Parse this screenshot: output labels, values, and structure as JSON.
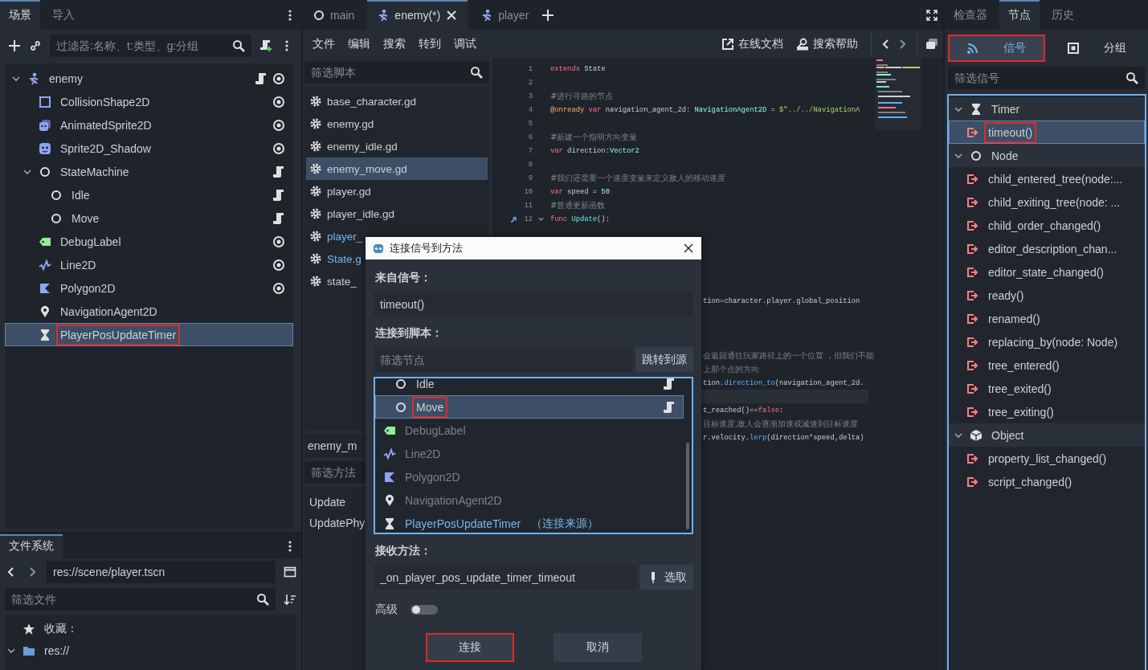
{
  "scene_dock": {
    "tabs": [
      {
        "label": "场景",
        "selected": true
      },
      {
        "label": "导入",
        "selected": false
      }
    ],
    "filter": {
      "placeholder": "过滤器:名称、t:类型、g:分组"
    },
    "tree": [
      {
        "name": "enemy",
        "kind": "character",
        "script": true,
        "eye": true,
        "selected": false,
        "highlighted": false,
        "expanded": true,
        "children": [
          {
            "name": "CollisionShape2D",
            "kind": "collision",
            "script": false,
            "eye": true,
            "selected": false,
            "highlighted": false
          },
          {
            "name": "AnimatedSprite2D",
            "kind": "animated",
            "script": false,
            "eye": true,
            "selected": false,
            "highlighted": false
          },
          {
            "name": "Sprite2D_Shadow",
            "kind": "sprite",
            "script": false,
            "eye": true,
            "selected": false,
            "highlighted": false
          },
          {
            "name": "StateMachine",
            "kind": "node",
            "script": true,
            "eye": false,
            "selected": false,
            "highlighted": false,
            "expanded": true,
            "children": [
              {
                "name": "Idle",
                "kind": "node",
                "script": true,
                "eye": false,
                "selected": false,
                "highlighted": false
              },
              {
                "name": "Move",
                "kind": "node",
                "script": true,
                "eye": false,
                "selected": false,
                "highlighted": false
              }
            ]
          },
          {
            "name": "DebugLabel",
            "kind": "label",
            "script": false,
            "eye": true,
            "selected": false,
            "highlighted": false
          },
          {
            "name": "Line2D",
            "kind": "line",
            "script": false,
            "eye": true,
            "selected": false,
            "highlighted": false
          },
          {
            "name": "Polygon2D",
            "kind": "polygon",
            "script": false,
            "eye": true,
            "selected": false,
            "highlighted": false
          },
          {
            "name": "NavigationAgent2D",
            "kind": "navigation",
            "script": false,
            "eye": false,
            "selected": false,
            "highlighted": false
          },
          {
            "name": "PlayerPosUpdateTimer",
            "kind": "timer",
            "script": false,
            "eye": false,
            "selected": true,
            "highlighted": true
          }
        ]
      }
    ]
  },
  "file_dock": {
    "tabs": [
      {
        "label": "文件系统",
        "selected": true
      }
    ],
    "path": "res://scene/player.tscn",
    "filter": {
      "placeholder": "筛选文件"
    },
    "items": [
      {
        "label": "收藏：",
        "kind": "favorites"
      },
      {
        "label": "res://",
        "kind": "folder",
        "expanded": true
      }
    ]
  },
  "script_editor": {
    "tabs": [
      {
        "label": "main",
        "kind": "node",
        "selected": false,
        "closable": false
      },
      {
        "label": "enemy(*)",
        "kind": "character",
        "selected": true,
        "closable": true
      },
      {
        "label": "player",
        "kind": "character",
        "selected": false,
        "closable": false
      }
    ],
    "menu": [
      "文件",
      "编辑",
      "搜索",
      "转到",
      "调试"
    ],
    "tools": [
      {
        "label": "在线文档",
        "kind": "external"
      },
      {
        "label": "搜索帮助",
        "kind": "doc"
      }
    ],
    "script_filter": {
      "placeholder": "筛选脚本"
    },
    "scripts": [
      {
        "label": "base_character.gd",
        "selected": false,
        "color": "#cdcfd2"
      },
      {
        "label": "enemy.gd",
        "selected": false,
        "color": "#cdcfd2"
      },
      {
        "label": "enemy_idle.gd",
        "selected": false,
        "color": "#cdcfd2"
      },
      {
        "label": "enemy_move.gd",
        "selected": true,
        "color": "#cdcfd2"
      },
      {
        "label": "player.gd",
        "selected": false,
        "color": "#cdcfd2"
      },
      {
        "label": "player_idle.gd",
        "selected": false,
        "color": "#cdcfd2"
      },
      {
        "label": "player_",
        "selected": false,
        "color": "#78b6ec"
      },
      {
        "label": "State.g",
        "selected": false,
        "color": "#78b6ec"
      },
      {
        "label": "state_",
        "selected": false,
        "color": "#cdcfd2"
      }
    ],
    "method_panel": {
      "title": "enemy_m",
      "filter": {
        "placeholder": "筛选方法"
      },
      "methods": [
        "Update",
        "UpdatePhy"
      ]
    },
    "code": {
      "lines": [
        {
          "kind": "full",
          "number": "1",
          "tokens": [
            {
              "kind": "kw",
              "s": "extends"
            },
            {
              "kind": "text",
              "s": " State"
            }
          ]
        },
        {
          "kind": "full",
          "number": "2"
        },
        {
          "kind": "full",
          "number": "3",
          "tokens": [
            {
              "kind": "comment",
              "s": "#进行寻路的节点"
            }
          ]
        },
        {
          "kind": "full",
          "number": "4",
          "tokens": [
            {
              "kind": "annot",
              "s": "@onready"
            },
            {
              "kind": "kw",
              "s": " var"
            },
            {
              "kind": "text",
              "s": " navigation_agent_2d: "
            },
            {
              "kind": "type",
              "s": "NavigationAgent2D"
            },
            {
              "kind": "text",
              "s": " = "
            },
            {
              "kind": "string",
              "s": "$\"../../NavigationA"
            }
          ]
        },
        {
          "kind": "full",
          "number": "5"
        },
        {
          "kind": "full",
          "number": "6",
          "tokens": [
            {
              "kind": "comment",
              "s": "#新建一个指明方向变量"
            }
          ]
        },
        {
          "kind": "full",
          "number": "7",
          "tokens": [
            {
              "kind": "kw",
              "s": "var"
            },
            {
              "kind": "text",
              "s": " direction:"
            },
            {
              "kind": "type",
              "s": "Vector2"
            }
          ]
        },
        {
          "kind": "full",
          "number": "8"
        },
        {
          "kind": "full",
          "number": "9",
          "tokens": [
            {
              "kind": "comment",
              "s": "#我们还需要一个速度变量来定义敌人的移动速度"
            }
          ]
        },
        {
          "kind": "full",
          "number": "10",
          "tokens": [
            {
              "kind": "kw",
              "s": "var"
            },
            {
              "kind": "text",
              "s": " speed = "
            },
            {
              "kind": "number",
              "s": "50"
            }
          ]
        },
        {
          "kind": "full",
          "number": "11",
          "tokens": [
            {
              "kind": "comment",
              "s": "#普通更新函数"
            }
          ]
        },
        {
          "kind": "function",
          "number": "12",
          "tokens": [
            {
              "kind": "kw",
              "s": "func"
            },
            {
              "kind": "fname",
              "s": " Update"
            },
            {
              "kind": "text",
              "s": "():"
            }
          ]
        },
        {
          "kind": "covered"
        },
        {
          "kind": "covered"
        },
        {
          "kind": "covered"
        },
        {
          "kind": "covered"
        },
        {
          "kind": "covered"
        },
        {
          "kind": "clipped",
          "tokens": [
            {
              "kind": "text",
              "s": "tion=character.player.global_position"
            }
          ]
        },
        {
          "kind": "covered"
        },
        {
          "kind": "covered"
        },
        {
          "kind": "covered"
        },
        {
          "kind": "clipped",
          "tokens": [
            {
              "kind": "comment",
              "s": "会返回通往玩家路径上的一个位置 ，但我们不能"
            }
          ]
        },
        {
          "kind": "clipped",
          "tokens": [
            {
              "kind": "comment",
              "s": "上那个点的方向"
            }
          ]
        },
        {
          "kind": "clipped",
          "tokens": [
            {
              "kind": "text",
              "s": "tion."
            },
            {
              "kind": "func",
              "s": "direction_to"
            },
            {
              "kind": "text",
              "s": "(navigation_agent_2d."
            }
          ]
        },
        {
          "kind": "current"
        },
        {
          "kind": "clipped",
          "tokens": [
            {
              "kind": "text",
              "s": "t_reached()=="
            },
            {
              "kind": "kw",
              "s": "false"
            },
            {
              "kind": "text",
              "s": ":"
            }
          ]
        },
        {
          "kind": "clipped",
          "tokens": [
            {
              "kind": "comment",
              "s": "目标速度,敌人会逐渐加速或减速到目标速度"
            }
          ]
        },
        {
          "kind": "clipped",
          "tokens": [
            {
              "kind": "text",
              "s": "r.velocity."
            },
            {
              "kind": "func",
              "s": "lerp"
            },
            {
              "kind": "text",
              "s": "(direction*speed,delta)"
            }
          ]
        }
      ]
    }
  },
  "node_dock": {
    "tabs": [
      {
        "label": "检查器",
        "selected": false
      },
      {
        "label": "节点",
        "selected": true
      },
      {
        "label": "历史",
        "selected": false
      }
    ],
    "subtabs": [
      {
        "label": "信号",
        "kind": "signal",
        "selected": true,
        "highlighted": true
      },
      {
        "label": "分组",
        "kind": "group",
        "selected": false,
        "highlighted": false
      }
    ],
    "filter": {
      "placeholder": "筛选信号"
    },
    "classes": [
      {
        "name": "Timer",
        "kind": "timer",
        "expanded": true,
        "children": [
          {
            "name": "timeout()",
            "selected": true,
            "highlighted": true
          }
        ]
      },
      {
        "name": "Node",
        "kind": "node",
        "expanded": true,
        "children": [
          {
            "name": "child_entered_tree(node:...",
            "selected": false,
            "highlighted": false
          },
          {
            "name": "child_exiting_tree(node: ...",
            "selected": false,
            "highlighted": false
          },
          {
            "name": "child_order_changed()",
            "selected": false,
            "highlighted": false
          },
          {
            "name": "editor_description_chan...",
            "selected": false,
            "highlighted": false
          },
          {
            "name": "editor_state_changed()",
            "selected": false,
            "highlighted": false
          },
          {
            "name": "ready()",
            "selected": false,
            "highlighted": false
          },
          {
            "name": "renamed()",
            "selected": false,
            "highlighted": false
          },
          {
            "name": "replacing_by(node: Node)",
            "selected": false,
            "highlighted": false
          },
          {
            "name": "tree_entered()",
            "selected": false,
            "highlighted": false
          },
          {
            "name": "tree_exited()",
            "selected": false,
            "highlighted": false
          },
          {
            "name": "tree_exiting()",
            "selected": false,
            "highlighted": false
          }
        ]
      },
      {
        "name": "Object",
        "kind": "object",
        "expanded": true,
        "children": [
          {
            "name": "property_list_changed()",
            "selected": false,
            "highlighted": false
          },
          {
            "name": "script_changed()",
            "selected": false,
            "highlighted": false
          }
        ]
      }
    ]
  },
  "dialog": {
    "title": "连接信号到方法",
    "from_label": "来自信号：",
    "signal": "timeout()",
    "to_label": "连接到脚本：",
    "node_filter": {
      "placeholder": "筛选节点"
    },
    "jump_button": "跳转到源",
    "nodes": [
      {
        "children": [
          {
            "name": "Idle",
            "kind": "node",
            "disabled": false,
            "source": false,
            "script": true,
            "selected": false,
            "highlighted": false
          },
          {
            "name": "Move",
            "kind": "node",
            "disabled": false,
            "source": false,
            "script": true,
            "selected": true,
            "highlighted": true
          }
        ]
      },
      {
        "name": "DebugLabel",
        "kind": "label",
        "disabled": true,
        "source": false,
        "script": false,
        "selected": false,
        "highlighted": false
      },
      {
        "name": "Line2D",
        "kind": "line",
        "disabled": true,
        "source": false,
        "script": false,
        "selected": false,
        "highlighted": false
      },
      {
        "name": "Polygon2D",
        "kind": "polygon",
        "disabled": true,
        "source": false,
        "script": false,
        "selected": false,
        "highlighted": false
      },
      {
        "name": "NavigationAgent2D",
        "kind": "navigation",
        "disabled": true,
        "source": false,
        "script": false,
        "selected": false,
        "highlighted": false
      },
      {
        "name": "PlayerPosUpdateTimer",
        "kind": "timer",
        "disabled": false,
        "source": true,
        "note": "（连接来源）",
        "script": false,
        "selected": false,
        "highlighted": false
      }
    ],
    "method_label": "接收方法：",
    "method": "_on_player_pos_update_timer_timeout",
    "pick_button": "选取",
    "advanced": {
      "label": "高级",
      "on": false
    },
    "buttons": [
      {
        "label": "连接",
        "highlighted": true
      },
      {
        "label": "取消",
        "highlighted": false
      }
    ]
  }
}
